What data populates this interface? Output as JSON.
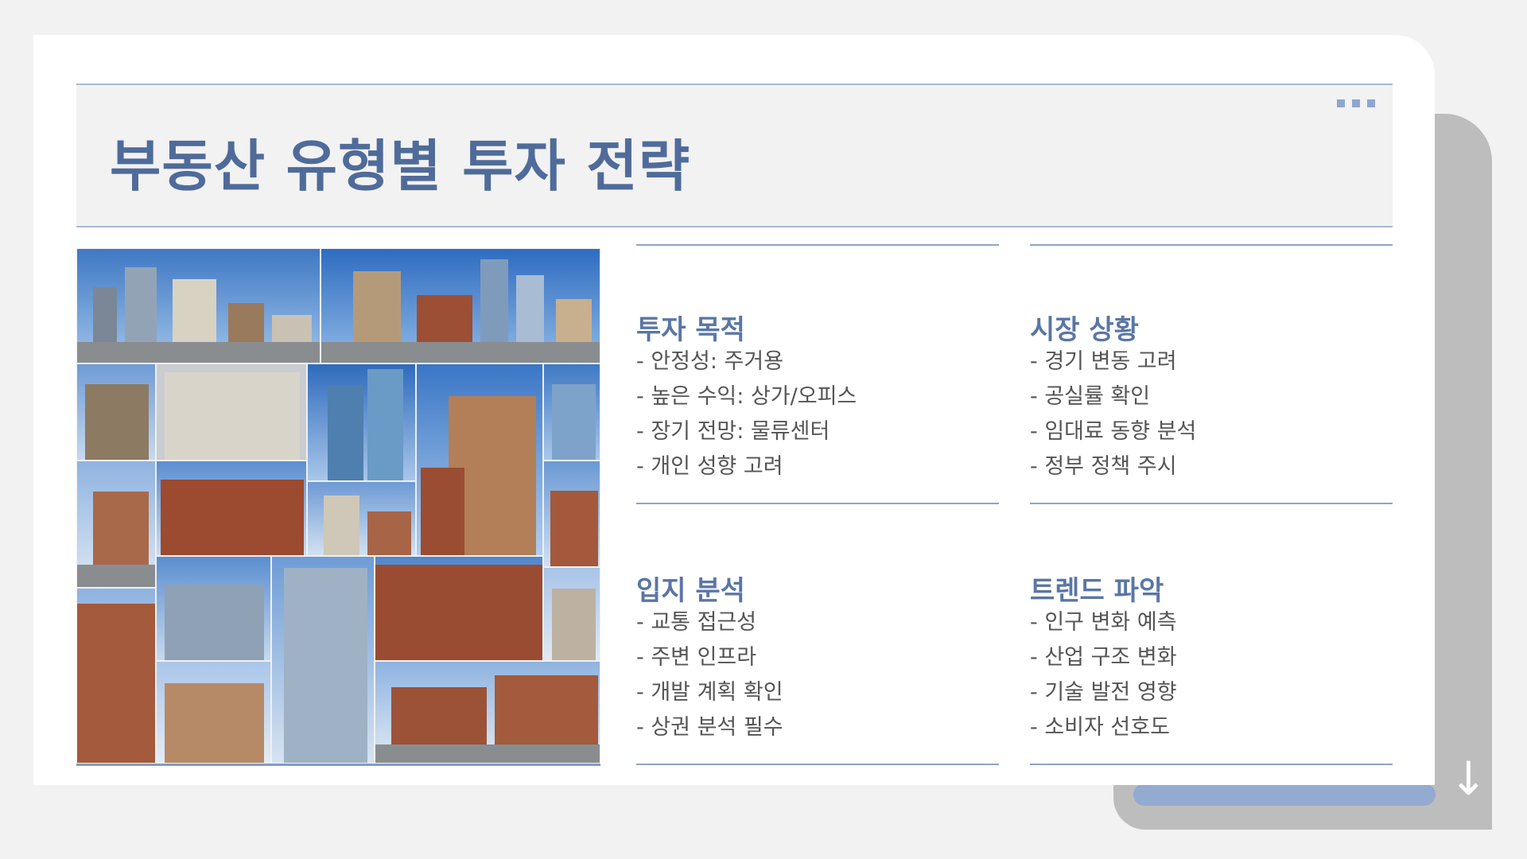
{
  "slide": {
    "title": "부동산 유형별 투자 전략"
  },
  "quadrants": [
    {
      "heading": "투자 목적",
      "items": [
        "- 안정성: 주거용",
        "- 높은 수익: 상가/오피스",
        "- 장기 전망: 물류센터",
        "- 개인 성향 고려"
      ]
    },
    {
      "heading": "시장 상황",
      "items": [
        "- 경기 변동 고려",
        "- 공실률 확인",
        "- 임대료 동향 분석",
        "- 정부 정책 주시"
      ]
    },
    {
      "heading": "입지 분석",
      "items": [
        "- 교통 접근성",
        "- 주변 인프라",
        "- 개발 계획 확인",
        "- 상권 분석 필수"
      ]
    },
    {
      "heading": "트렌드 파악",
      "items": [
        "- 인구 변화 예측",
        "- 산업 구조 변화",
        "- 기술 발전 영향",
        "- 소비자 선호도"
      ]
    }
  ],
  "icons": {
    "menu": "more-dots-icon",
    "next": "arrow-down-icon"
  },
  "colors": {
    "accent": "#5a76a6",
    "rule": "#8ea4c8",
    "text": "#555555"
  }
}
